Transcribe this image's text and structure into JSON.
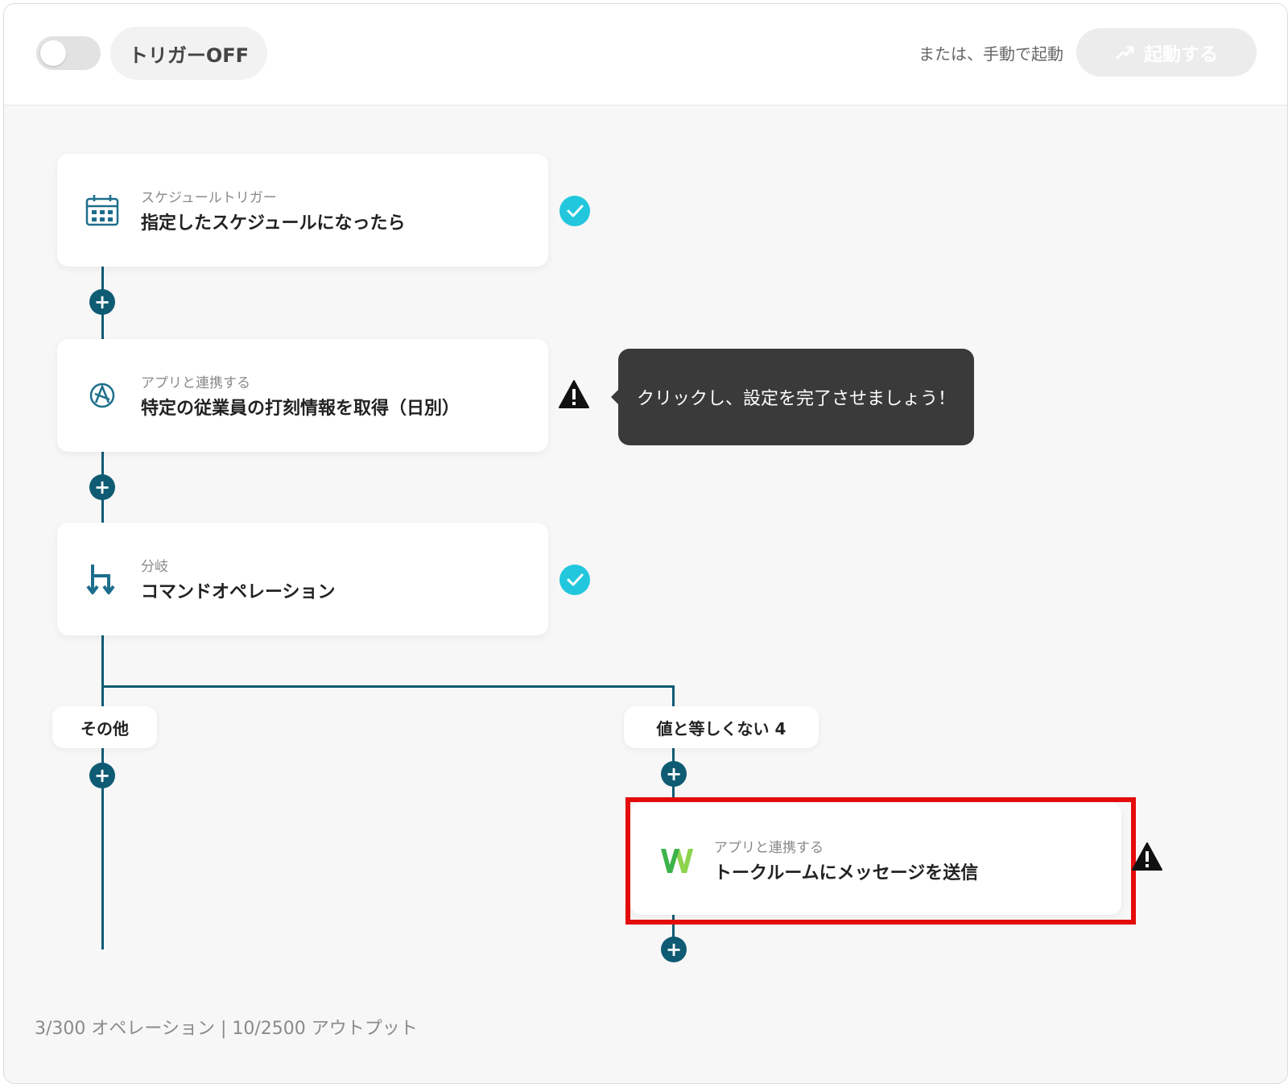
{
  "topbar": {
    "trigger_label": "トリガーOFF",
    "manual_label": "または、手動で起動",
    "start_button": "起動する"
  },
  "steps": [
    {
      "sub": "スケジュールトリガー",
      "title": "指定したスケジュールになったら",
      "icon": "calendar-schedule-icon",
      "status": "complete"
    },
    {
      "sub": "アプリと連携する",
      "title": "特定の従業員の打刻情報を取得（日別）",
      "icon": "app-logo-icon",
      "status": "warning"
    },
    {
      "sub": "分岐",
      "title": "コマンドオペレーション",
      "icon": "branch-icon",
      "status": "complete"
    }
  ],
  "tooltip": "クリックし、設定を完了させましょう！",
  "branches": {
    "left_label": "その他",
    "right_label": "値と等しくない 4"
  },
  "branch_step": {
    "sub": "アプリと連携する",
    "title": "トークルームにメッセージを送信",
    "icon": "w-logo-icon",
    "status": "warning"
  },
  "footer": "3/300 オペレーション | 10/2500 アウトプット",
  "colors": {
    "flow_line": "#0e5b73",
    "check": "#22c7dd",
    "highlight": "#e30b0b",
    "tooltip_bg": "#3a3a3a"
  }
}
